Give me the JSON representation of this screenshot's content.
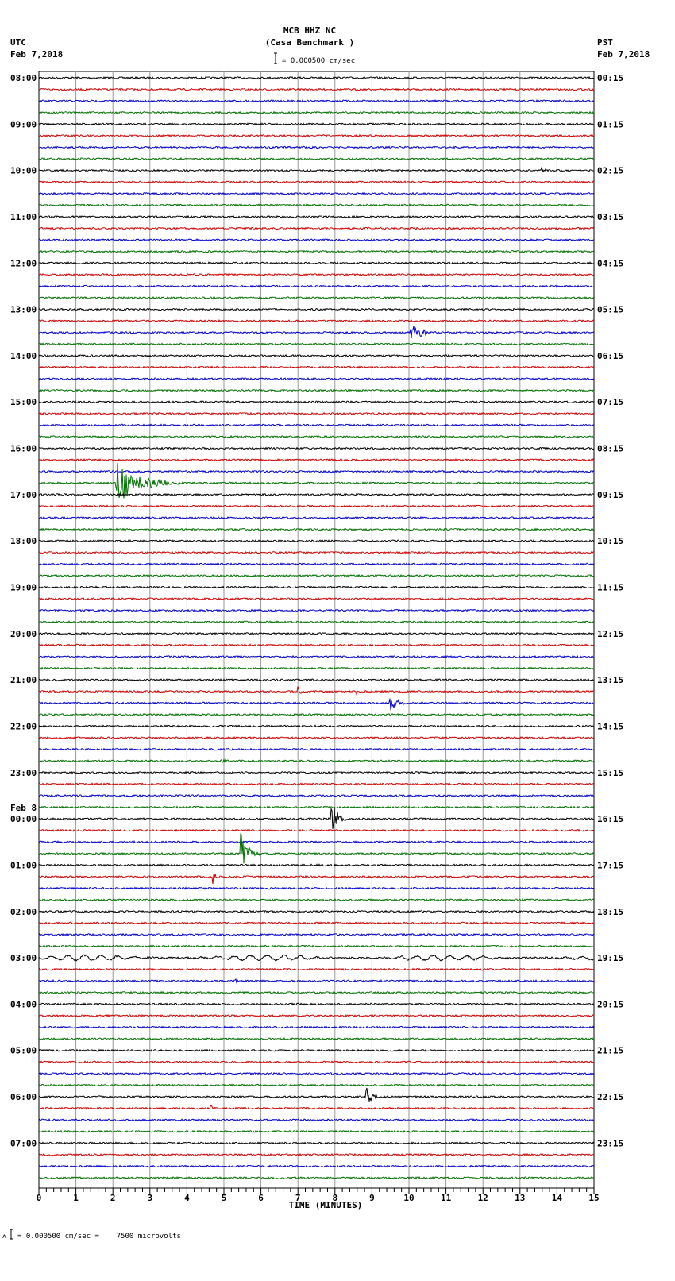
{
  "header": {
    "station": "MCB HHZ NC",
    "site": "(Casa Benchmark )",
    "left_tz": "UTC",
    "left_date": "Feb 7,2018",
    "right_tz": "PST",
    "right_date": "Feb 7,2018",
    "scale": "= 0.000500 cm/sec"
  },
  "footer": {
    "prefix": "ʌ",
    "scale": "= 0.000500 cm/sec =    7500 microvolts"
  },
  "chart_data": {
    "type": "line",
    "title": "MCB HHZ NC (Casa Benchmark )",
    "xlabel": "TIME (MINUTES)",
    "xlim": [
      0,
      15
    ],
    "x_ticks": [
      "0",
      "1",
      "2",
      "3",
      "4",
      "5",
      "6",
      "7",
      "8",
      "9",
      "10",
      "11",
      "12",
      "13",
      "14",
      "15"
    ],
    "grid": true,
    "trace_colors": [
      "#000000",
      "#d00000",
      "#0000d0",
      "#007000"
    ],
    "traces_per_hour": 4,
    "left_labels": [
      "08:00",
      "09:00",
      "10:00",
      "11:00",
      "12:00",
      "13:00",
      "14:00",
      "15:00",
      "16:00",
      "17:00",
      "18:00",
      "19:00",
      "20:00",
      "21:00",
      "22:00",
      "23:00",
      "00:00",
      "01:00",
      "02:00",
      "03:00",
      "04:00",
      "05:00",
      "06:00",
      "07:00"
    ],
    "date_change_label": "Feb 8",
    "right_labels": [
      "00:15",
      "01:15",
      "02:15",
      "03:15",
      "04:15",
      "05:15",
      "06:15",
      "07:15",
      "08:15",
      "09:15",
      "10:15",
      "11:15",
      "12:15",
      "13:15",
      "14:15",
      "15:15",
      "16:15",
      "17:15",
      "18:15",
      "19:15",
      "20:15",
      "21:15",
      "22:15",
      "23:15"
    ],
    "events": [
      {
        "trace": 8,
        "minute": 13.6,
        "amplitude": 3,
        "duration": 0.4
      },
      {
        "trace": 22,
        "minute": 10.05,
        "amplitude": 12,
        "duration": 0.8
      },
      {
        "trace": 35,
        "minute": 2.1,
        "amplitude": 30,
        "duration": 1.8
      },
      {
        "trace": 53,
        "minute": 7.0,
        "amplitude": 8,
        "duration": 0.2
      },
      {
        "trace": 53,
        "minute": 6.6,
        "amplitude": 3,
        "duration": 0.1
      },
      {
        "trace": 53,
        "minute": 8.6,
        "amplitude": 3,
        "duration": 0.1
      },
      {
        "trace": 54,
        "minute": 9.5,
        "amplitude": 10,
        "duration": 0.6
      },
      {
        "trace": 59,
        "minute": 4.95,
        "amplitude": 5,
        "duration": 0.2
      },
      {
        "trace": 64,
        "minute": 7.9,
        "amplitude": 26,
        "duration": 0.5
      },
      {
        "trace": 67,
        "minute": 5.45,
        "amplitude": 28,
        "duration": 0.6
      },
      {
        "trace": 69,
        "minute": 4.7,
        "amplitude": 9,
        "duration": 0.3
      },
      {
        "trace": 78,
        "minute": 5.3,
        "amplitude": 4,
        "duration": 0.2
      },
      {
        "trace": 88,
        "minute": 8.85,
        "amplitude": 14,
        "duration": 0.4
      },
      {
        "trace": 89,
        "minute": 4.65,
        "amplitude": 5,
        "duration": 0.2
      }
    ],
    "long_period_traces": [
      76
    ]
  }
}
